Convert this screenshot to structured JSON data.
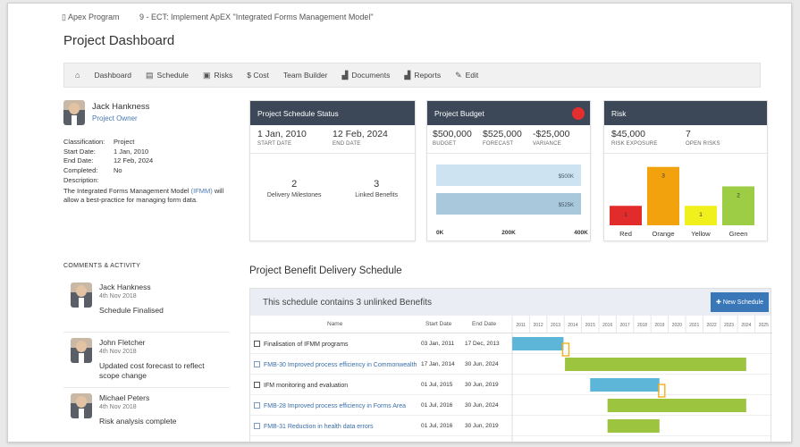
{
  "breadcrumb": {
    "program": "Apex Program",
    "project": "9 - ECT: Implement ApEX \"Integrated Forms Management Model\""
  },
  "page_title": "Project Dashboard",
  "nav": [
    {
      "icon": "home-icon",
      "glyph": "⌂",
      "label": ""
    },
    {
      "icon": "",
      "glyph": "",
      "label": "Dashboard"
    },
    {
      "icon": "calendar-icon",
      "glyph": "▤",
      "label": "Schedule"
    },
    {
      "icon": "risk-icon",
      "glyph": "▣",
      "label": "Risks"
    },
    {
      "icon": "",
      "glyph": "",
      "label": "$ Cost"
    },
    {
      "icon": "",
      "glyph": "",
      "label": "Team Builder"
    },
    {
      "icon": "documents-icon",
      "glyph": "▟",
      "label": "Documents"
    },
    {
      "icon": "reports-icon",
      "glyph": "▟",
      "label": "Reports"
    },
    {
      "icon": "edit-icon",
      "glyph": "✎",
      "label": "Edit"
    }
  ],
  "owner": {
    "name": "Jack Hankness",
    "role": "Project Owner"
  },
  "details": [
    {
      "k": "Classification:",
      "v": "Project"
    },
    {
      "k": "Start Date:",
      "v": "1 Jan, 2010"
    },
    {
      "k": "End Date:",
      "v": "12 Feb, 2024"
    },
    {
      "k": "Completed:",
      "v": "No"
    }
  ],
  "description_label": "Description:",
  "description_pre": "The Integrated Forms Management Model",
  "description_hl": "(IFMM)",
  "description_post": " will allow a best-practice for managing form data.",
  "comments_title": "COMMENTS & ACTIVITY",
  "comments": [
    {
      "name": "Jack Hankness",
      "date": "4th Nov 2018",
      "text": "Schedule Finalised"
    },
    {
      "name": "John Fletcher",
      "date": "4th Nov 2018",
      "text": "Updated cost forecast to reflect scope change"
    },
    {
      "name": "Michael Peters",
      "date": "4th Nov 2018",
      "text": "Risk analysis complete"
    }
  ],
  "schedule_card": {
    "title": "Project Schedule Status",
    "start": "1 Jan, 2010",
    "start_label": "START DATE",
    "end": "12 Feb, 2024",
    "end_label": "END DATE",
    "milestones": "2",
    "milestones_label": "Delivery Milestones",
    "benefits": "3",
    "benefits_label": "Linked Benefits"
  },
  "budget_card": {
    "title": "Project Budget",
    "budget": "$500,000",
    "budget_label": "BUDGET",
    "forecast": "$525,000",
    "forecast_label": "FORECAST",
    "variance": "-$25,000",
    "variance_label": "VARIANCE",
    "status_color": "#e52f2f"
  },
  "risk_card": {
    "title": "Risk",
    "exposure": "$45,000",
    "exposure_label": "RISK EXPOSURE",
    "open": "7",
    "open_label": "OPEN RISKS"
  },
  "schedule": {
    "title": "Project Benefit Delivery Schedule",
    "banner": "This schedule contains 3 unlinked Benefits",
    "new_button": "✚ New Schedule",
    "headers": {
      "name": "Name",
      "start": "Start Date",
      "end": "End Date"
    },
    "years": [
      "2011",
      "2012",
      "2013",
      "2014",
      "2015",
      "2016",
      "2017",
      "2018",
      "2019",
      "2020",
      "2021",
      "2022",
      "2023",
      "2024",
      "2025"
    ],
    "rows": [
      {
        "name": "Finalisation of IFMM programs",
        "start": "03 Jan, 2011",
        "end": "17 Dec, 2013",
        "link": false
      },
      {
        "name": "FMB-30 Improved process efficiency in Commonwealth",
        "start": "17 Jan, 2014",
        "end": "30 Jun, 2024",
        "link": true
      },
      {
        "name": "IFM monitoring and evaluation",
        "start": "01 Jul, 2015",
        "end": "30 Jun, 2019",
        "link": false
      },
      {
        "name": "FMB-28 Improved process efficiency in Forms Area",
        "start": "01 Jul, 2016",
        "end": "30 Jun, 2024",
        "link": true
      },
      {
        "name": "FMB-31 Reduction in health data errors",
        "start": "01 Jul, 2016",
        "end": "30 Jun, 2019",
        "link": true
      }
    ]
  },
  "chart_data": [
    {
      "type": "bar",
      "orientation": "horizontal",
      "categories": [
        "Budget",
        "Forecast"
      ],
      "values": [
        500000,
        525000
      ],
      "data_labels": [
        "$500K",
        "$525K"
      ],
      "xlim": [
        0,
        400000
      ],
      "x_ticks": [
        "0K",
        "200K",
        "400K"
      ],
      "colors": [
        "#cde3f1",
        "#a9c8dc"
      ]
    },
    {
      "type": "bar",
      "categories": [
        "Red",
        "Orange",
        "Yellow",
        "Green"
      ],
      "values": [
        1,
        3,
        1,
        2
      ],
      "colors": [
        "#e22c2c",
        "#f2a20c",
        "#f0f01c",
        "#9dcd45"
      ],
      "ylim": [
        0,
        3.4
      ]
    },
    {
      "type": "gantt",
      "x_range": [
        "2011-01-01",
        "2025-12-31"
      ],
      "tasks": [
        {
          "name": "Finalisation of IFMM programs",
          "start": "2011-01-03",
          "end": "2013-12-17",
          "kind": "summary"
        },
        {
          "name": "FMB-30 Improved process efficiency in Commonwealth",
          "start": "2014-01-17",
          "end": "2024-06-30",
          "kind": "benefit"
        },
        {
          "name": "IFM monitoring and evaluation",
          "start": "2015-07-01",
          "end": "2019-06-30",
          "kind": "summary"
        },
        {
          "name": "FMB-28 Improved process efficiency in Forms Area",
          "start": "2016-07-01",
          "end": "2024-06-30",
          "kind": "benefit"
        },
        {
          "name": "FMB-31 Reduction in health data errors",
          "start": "2016-07-01",
          "end": "2019-06-30",
          "kind": "benefit"
        }
      ],
      "colors": {
        "summary": "#5db6d8",
        "benefit": "#9dc43e",
        "connector": "#f2b01c"
      }
    }
  ]
}
